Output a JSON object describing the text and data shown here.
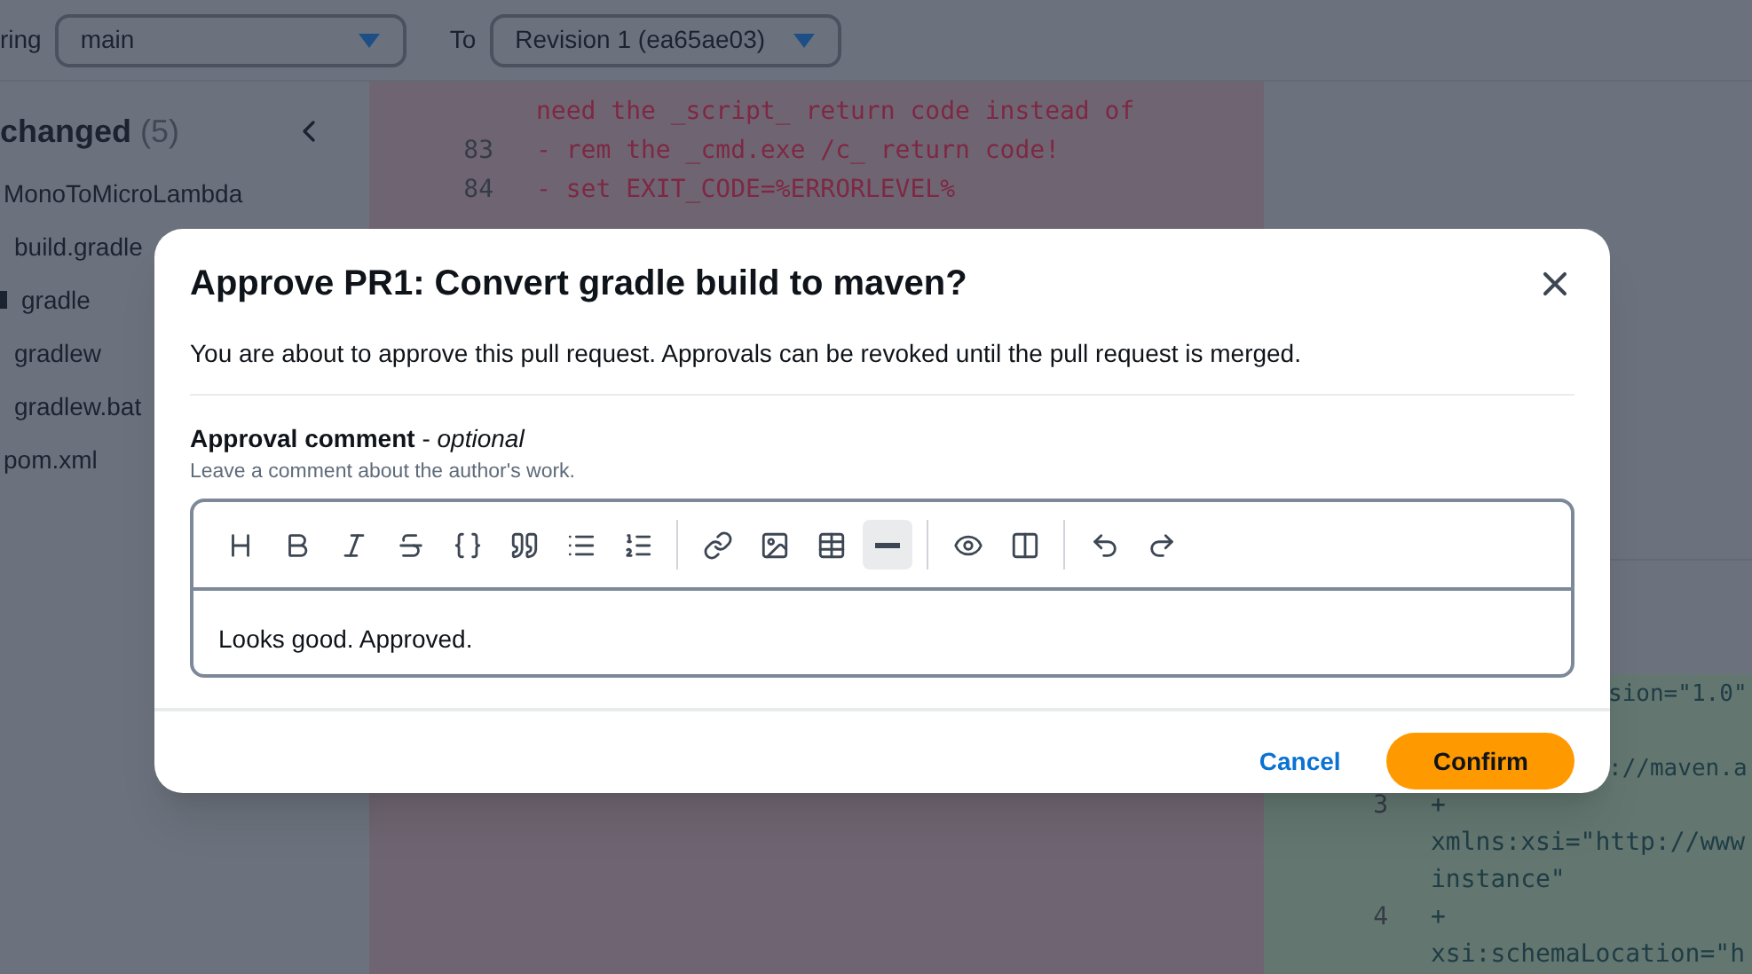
{
  "compare_bar": {
    "from_label": "ring",
    "from_value": "main",
    "to_label": "To",
    "to_value": "Revision 1 (ea65ae03)"
  },
  "sidebar": {
    "title": "changed",
    "count": "(5)",
    "items": [
      {
        "label": "MonoToMicroLambda",
        "folder": false,
        "children": [
          {
            "label": "build.gradle",
            "folder": false
          },
          {
            "label": "gradle",
            "folder": true
          },
          {
            "label": "gradlew",
            "folder": false
          },
          {
            "label": "gradlew.bat",
            "folder": false
          }
        ]
      },
      {
        "label": "pom.xml",
        "folder": false
      }
    ]
  },
  "removed_lines": [
    {
      "text": "need the _script_ return code instead of"
    },
    {
      "number": "83",
      "text": "- rem the _cmd.exe /c_ return code!"
    },
    {
      "number": "84",
      "text": "- set EXIT_CODE=%ERRORLEVEL%"
    }
  ],
  "added_lines": [
    {
      "text": "sion=\"1.0\"",
      "partial": true
    },
    {
      "text": "://maven.a",
      "partial": true
    },
    {
      "number": "3",
      "text": "+"
    },
    {
      "text": "xmlns:xsi=\"http://www"
    },
    {
      "text": "instance\""
    },
    {
      "number": "4",
      "text": "+"
    },
    {
      "text": "xsi:schemaLocation=\"h"
    }
  ],
  "dialog": {
    "title": "Approve PR1: Convert gradle build to maven?",
    "description": "You are about to approve this pull request. Approvals can be revoked until the pull request is merged.",
    "field_label": "Approval comment",
    "field_label_separator": "-",
    "field_label_suffix": "optional",
    "field_hint": "Leave a comment about the author's work.",
    "toolbar": [
      [
        {
          "kind": "heading",
          "active": false
        },
        {
          "kind": "bold",
          "active": false
        },
        {
          "kind": "italic",
          "active": false
        },
        {
          "kind": "strike",
          "active": false
        },
        {
          "kind": "code",
          "active": false
        },
        {
          "kind": "quote",
          "active": false
        },
        {
          "kind": "bullets",
          "active": false
        },
        {
          "kind": "numbers",
          "active": false
        }
      ],
      [
        {
          "kind": "link",
          "active": false
        },
        {
          "kind": "image",
          "active": false
        },
        {
          "kind": "table",
          "active": false
        },
        {
          "kind": "rule",
          "active": true
        }
      ],
      [
        {
          "kind": "preview",
          "active": false
        },
        {
          "kind": "split",
          "active": false
        }
      ],
      [
        {
          "kind": "undo",
          "active": false
        },
        {
          "kind": "redo",
          "active": false
        }
      ]
    ],
    "value": "Looks good. Approved.",
    "buttons": [
      {
        "label": "Cancel",
        "kind": "link"
      },
      {
        "label": "Confirm",
        "kind": "primary"
      }
    ]
  }
}
